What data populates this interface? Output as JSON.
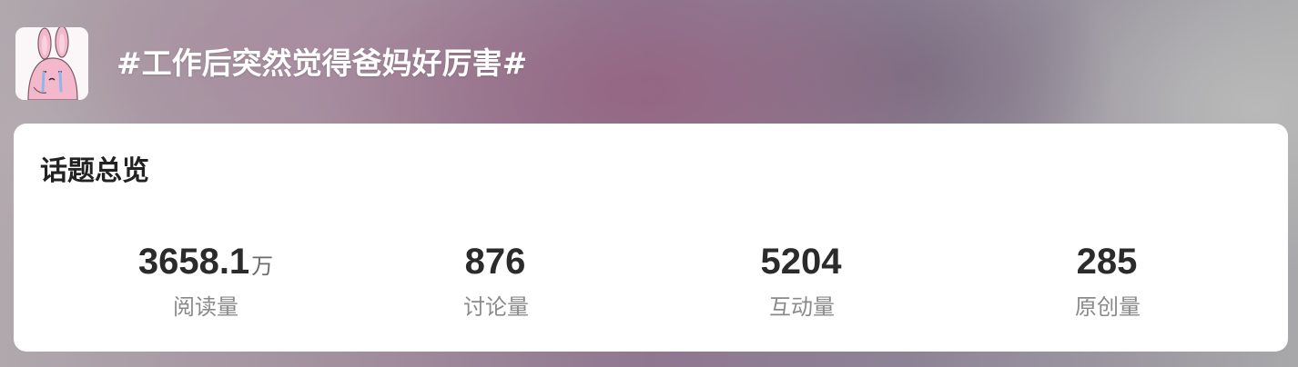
{
  "topic": {
    "title": "#工作后突然觉得爸妈好厉害#"
  },
  "overview": {
    "title": "话题总览",
    "stats": [
      {
        "value": "3658.1",
        "unit": "万",
        "label": "阅读量"
      },
      {
        "value": "876",
        "unit": "",
        "label": "讨论量"
      },
      {
        "value": "5204",
        "unit": "",
        "label": "互动量"
      },
      {
        "value": "285",
        "unit": "",
        "label": "原创量"
      }
    ]
  },
  "colors": {
    "card_background": "#ffffff",
    "title_text": "#ffffff",
    "value_text": "#2b2b2b",
    "label_text": "#8a8a8a",
    "avatar_pink": "#f4b8cc"
  },
  "icons": {
    "avatar": "crying-pink-rabbit-avatar"
  }
}
